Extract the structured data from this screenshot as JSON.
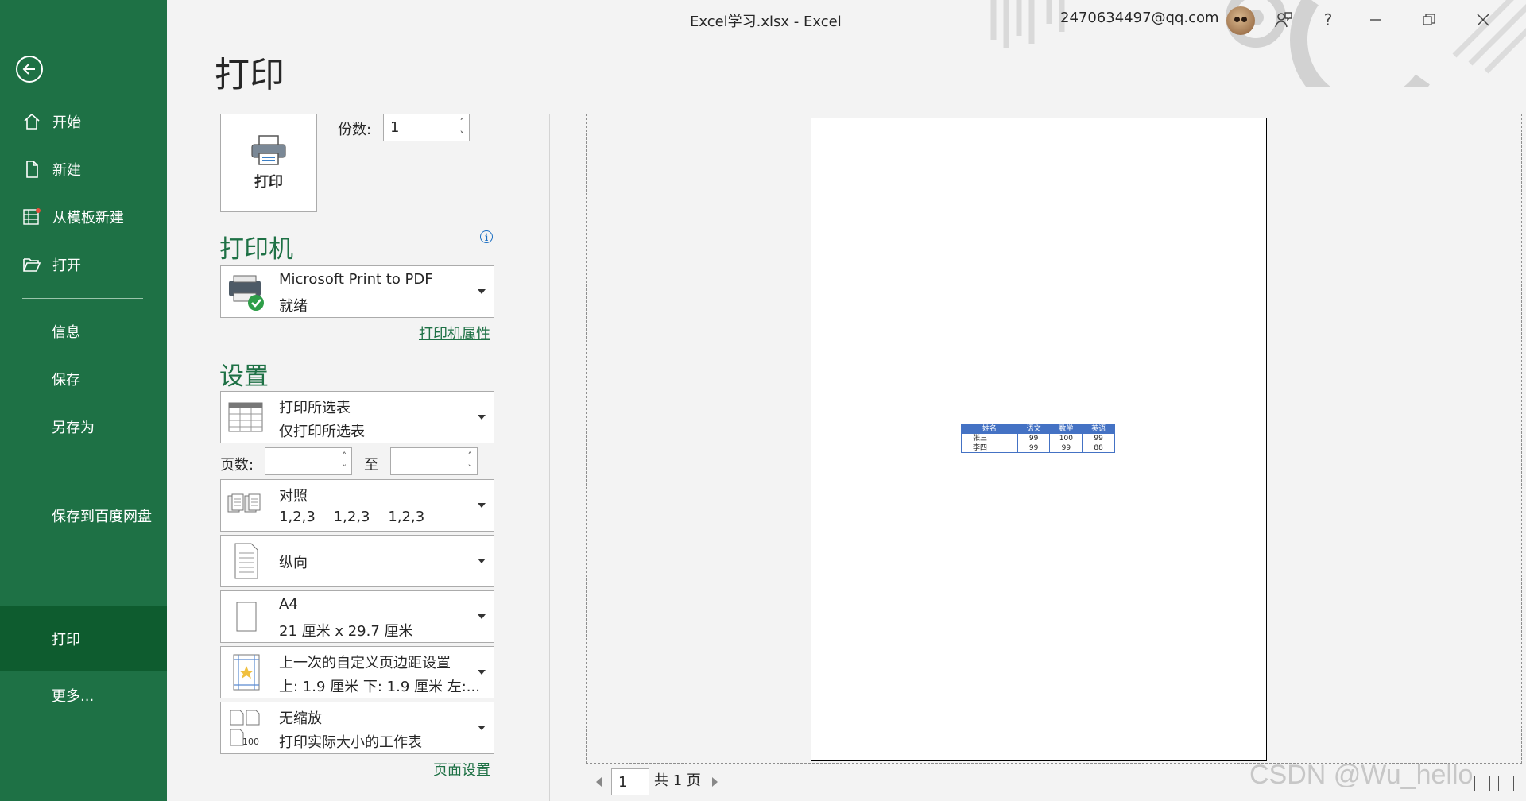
{
  "window": {
    "title": "Excel学习.xlsx  -  Excel",
    "user_email": "2470634497@qq.com"
  },
  "sidebar": {
    "items": [
      {
        "label": "开始",
        "icon": "home-icon"
      },
      {
        "label": "新建",
        "icon": "new-file-icon"
      },
      {
        "label": "从模板新建",
        "icon": "template-icon"
      },
      {
        "label": "打开",
        "icon": "open-folder-icon"
      },
      {
        "label": "信息"
      },
      {
        "label": "保存"
      },
      {
        "label": "另存为"
      },
      {
        "label": "保存到百度网盘"
      },
      {
        "label": "打印"
      },
      {
        "label": "更多..."
      }
    ],
    "active": "打印"
  },
  "page_title": "打印",
  "print_button": {
    "label": "打印"
  },
  "copies": {
    "label": "份数:",
    "value": "1"
  },
  "printer": {
    "heading": "打印机",
    "name": "Microsoft Print to PDF",
    "status": "就绪",
    "properties_link": "打印机属性"
  },
  "settings": {
    "heading": "设置",
    "scope": {
      "title": "打印所选表",
      "subtitle": "仅打印所选表"
    },
    "pages": {
      "label": "页数:",
      "to_label": "至",
      "from": "",
      "to": ""
    },
    "collate": {
      "title": "对照",
      "subtitle": "1,2,3    1,2,3    1,2,3"
    },
    "orientation": {
      "title": "纵向"
    },
    "paper": {
      "title": "A4",
      "subtitle": "21 厘米 x 29.7 厘米"
    },
    "margins": {
      "title": "上一次的自定义页边距设置",
      "subtitle": "上: 1.9 厘米 下: 1.9 厘米 左:..."
    },
    "scaling": {
      "title": "无缩放",
      "subtitle": "打印实际大小的工作表",
      "badge": "100"
    },
    "page_setup_link": "页面设置"
  },
  "preview": {
    "table": {
      "headers": [
        "姓名",
        "语文",
        "数学",
        "英语"
      ],
      "rows": [
        [
          "张三",
          "99",
          "100",
          "99"
        ],
        [
          "李四",
          "99",
          "99",
          "88"
        ]
      ]
    },
    "current_page": "1",
    "total_pages": "共 1 页"
  },
  "watermark": "CSDN @Wu_hello",
  "colors": {
    "accent": "#1e7145",
    "active_nav": "#0e5c2f",
    "table_header": "#4472c4"
  }
}
